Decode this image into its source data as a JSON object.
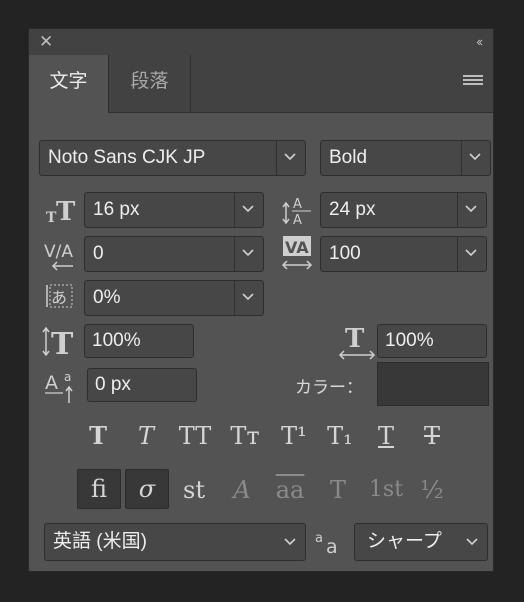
{
  "titlebar": {
    "close_icon": "close-icon",
    "collapse_icon": "double-chevron-left-icon",
    "collapse_glyph": "‹‹"
  },
  "tabs": [
    {
      "label": "文字",
      "active": true
    },
    {
      "label": "段落",
      "active": false
    }
  ],
  "font": {
    "family": "Noto Sans CJK JP",
    "style": "Bold"
  },
  "size": {
    "font_size": "16 px",
    "leading": "24 px"
  },
  "spacing": {
    "kerning": "0",
    "tracking": "100"
  },
  "tsume": {
    "value": "0%"
  },
  "scale": {
    "vertical": "100%",
    "horizontal": "100%"
  },
  "baseline": {
    "shift": "0 px"
  },
  "color": {
    "label": "カラー：",
    "value": "#383838"
  },
  "style_buttons": [
    {
      "name": "faux-bold",
      "glyph": "T"
    },
    {
      "name": "faux-italic",
      "glyph": "T"
    },
    {
      "name": "all-caps",
      "glyph": "TT"
    },
    {
      "name": "small-caps",
      "glyph": "Tт"
    },
    {
      "name": "superscript",
      "glyph": "T¹"
    },
    {
      "name": "subscript",
      "glyph": "T₁"
    },
    {
      "name": "underline",
      "glyph": "T"
    },
    {
      "name": "strikethrough",
      "glyph": "T"
    }
  ],
  "opentype_buttons": [
    {
      "name": "standard-ligatures",
      "glyph": "fi"
    },
    {
      "name": "contextual-alternates",
      "glyph": "σ"
    },
    {
      "name": "discretionary-ligatures",
      "glyph": "st"
    },
    {
      "name": "swash",
      "glyph": "A"
    },
    {
      "name": "stylistic-alternates",
      "glyph": "aa"
    },
    {
      "name": "titling-alternates",
      "glyph": "T"
    },
    {
      "name": "ordinals",
      "glyph": "1st"
    },
    {
      "name": "fractions",
      "glyph": "½"
    }
  ],
  "language": {
    "value": "英語 (米国)"
  },
  "antialias": {
    "value": "シャープ"
  }
}
